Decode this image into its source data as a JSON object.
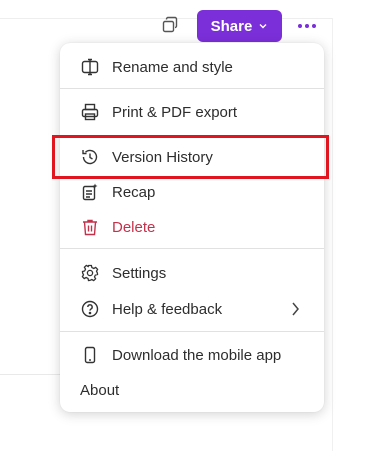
{
  "toolbar": {
    "share_label": "Share"
  },
  "menu": {
    "items": [
      {
        "label": "Rename and style",
        "icon": "rename-icon"
      },
      {
        "label": "Print & PDF export",
        "icon": "printer-icon"
      },
      {
        "label": "Version History",
        "icon": "history-icon"
      },
      {
        "label": "Recap",
        "icon": "recap-icon"
      },
      {
        "label": "Delete",
        "icon": "trash-icon",
        "color": "#c4314b"
      },
      {
        "label": "Settings",
        "icon": "gear-icon"
      },
      {
        "label": "Help & feedback",
        "icon": "help-icon"
      },
      {
        "label": "Download the mobile app",
        "icon": "phone-icon"
      },
      {
        "label": "About"
      }
    ]
  },
  "colors": {
    "accent": "#7b2fd9",
    "danger": "#c4314b",
    "highlight": "#e0151f"
  }
}
